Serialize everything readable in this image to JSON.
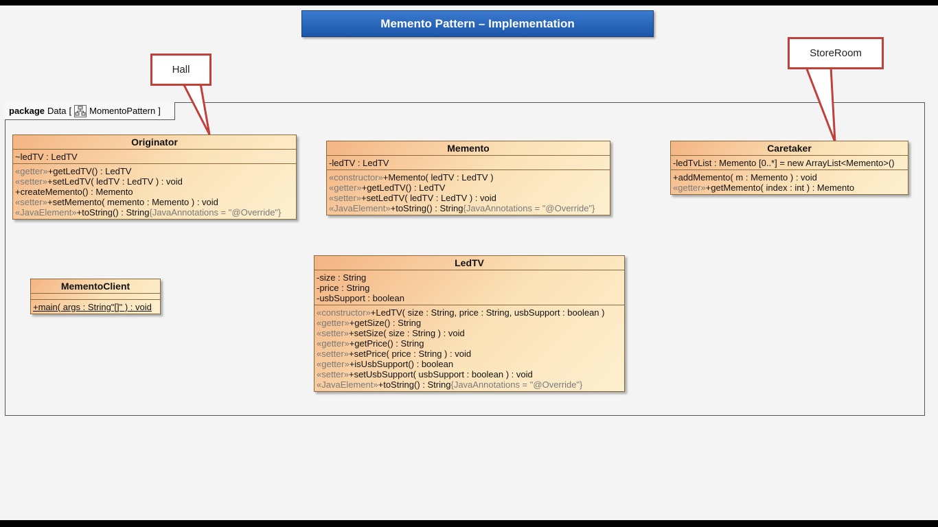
{
  "title": "Memento Pattern – Implementation",
  "package": {
    "keyword": "package",
    "name": "Data",
    "open_bracket": "[",
    "diagram": "MomentoPattern",
    "close_bracket": "]"
  },
  "callouts": {
    "hall": "Hall",
    "storeroom": "StoreRoom"
  },
  "classes": {
    "originator": {
      "name": "Originator",
      "attributes": [
        {
          "text": "~ledTV : LedTV"
        }
      ],
      "operations": [
        {
          "stereo": "«getter»",
          "text": "+getLedTV() : LedTV"
        },
        {
          "stereo": "«setter»",
          "text": "+setLedTV( ledTV : LedTV ) : void"
        },
        {
          "text": "+createMemento() : Memento"
        },
        {
          "stereo": "«setter»",
          "text": "+setMemento( memento : Memento ) : void"
        },
        {
          "stereo": "«JavaElement»",
          "text": "+toString() : String",
          "annotation": "{JavaAnnotations = \"@Override\"}"
        }
      ]
    },
    "memento": {
      "name": "Memento",
      "attributes": [
        {
          "text": "-ledTV : LedTV"
        }
      ],
      "operations": [
        {
          "stereo": "«constructor»",
          "text": "+Memento( ledTV : LedTV )"
        },
        {
          "stereo": "«getter»",
          "text": "+getLedTV() : LedTV"
        },
        {
          "stereo": "«setter»",
          "text": "+setLedTV( ledTV : LedTV ) : void"
        },
        {
          "stereo": "«JavaElement»",
          "text": "+toString() : String",
          "annotation": "{JavaAnnotations = \"@Override\"}"
        }
      ]
    },
    "caretaker": {
      "name": "Caretaker",
      "attributes": [
        {
          "text": "-ledTvList : Memento [0..*] = new ArrayList<Memento>()"
        }
      ],
      "operations": [
        {
          "text": "+addMemento( m : Memento ) : void"
        },
        {
          "stereo": "«getter»",
          "text": "+getMemento( index : int ) : Memento"
        }
      ]
    },
    "memento_client": {
      "name": "MementoClient",
      "operations": [
        {
          "text": "+main( args : String\"[]\" ) : void"
        }
      ]
    },
    "ledtv": {
      "name": "LedTV",
      "attributes": [
        {
          "text": "-size : String"
        },
        {
          "text": "-price : String"
        },
        {
          "text": "-usbSupport : boolean"
        }
      ],
      "operations": [
        {
          "stereo": "«constructor»",
          "text": "+LedTV( size : String, price : String, usbSupport : boolean )"
        },
        {
          "stereo": "«getter»",
          "text": "+getSize() : String"
        },
        {
          "stereo": "«setter»",
          "text": "+setSize( size : String ) : void"
        },
        {
          "stereo": "«getter»",
          "text": "+getPrice() : String"
        },
        {
          "stereo": "«setter»",
          "text": "+setPrice( price : String ) : void"
        },
        {
          "stereo": "«getter»",
          "text": "+isUsbSupport() : boolean"
        },
        {
          "stereo": "«setter»",
          "text": "+setUsbSupport( usbSupport : boolean ) : void"
        },
        {
          "stereo": "«JavaElement»",
          "text": "+toString() : String",
          "annotation": "{JavaAnnotations = \"@Override\"}"
        }
      ]
    }
  }
}
